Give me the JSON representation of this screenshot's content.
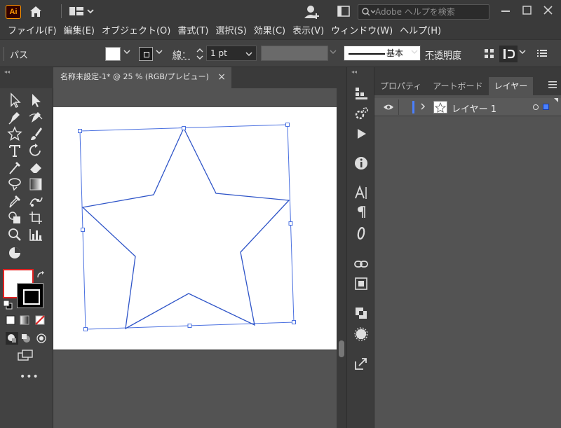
{
  "app": {
    "logo_text": "Ai",
    "accent": "#ff9a00",
    "selection_color": "#4a80ff"
  },
  "search": {
    "placeholder": "Adobe ヘルプを検索"
  },
  "menu": [
    "ファイル(F)",
    "編集(E)",
    "オブジェクト(O)",
    "書式(T)",
    "選択(S)",
    "効果(C)",
    "表示(V)",
    "ウィンドウ(W)",
    "ヘルプ(H)"
  ],
  "control_bar": {
    "object_type": "パス",
    "stroke_label": "線：",
    "stroke_weight": "1 pt",
    "stroke_profile": "基本",
    "opacity_label": "不透明度"
  },
  "document_tab": {
    "title": "名称未設定-1* @ 25 % (RGB/プレビュー)",
    "close": "×"
  },
  "panel": {
    "tabs": [
      {
        "label": "プロパティ",
        "active": false
      },
      {
        "label": "アートボード",
        "active": false
      },
      {
        "label": "レイヤー",
        "active": true
      }
    ],
    "layers": [
      {
        "name": "レイヤー 1"
      }
    ]
  },
  "toolbar": {
    "more": "•••"
  }
}
